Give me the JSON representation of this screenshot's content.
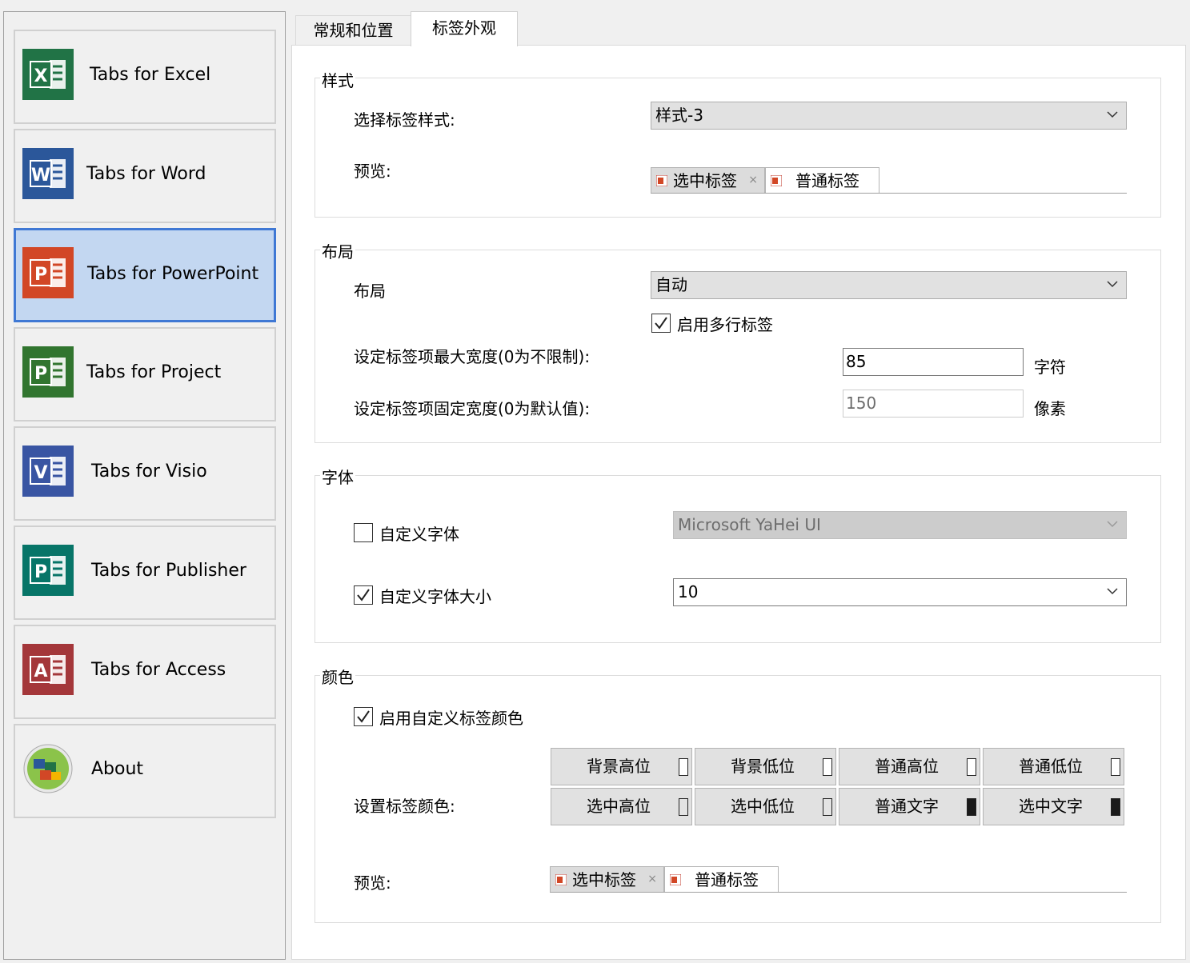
{
  "sidebar": {
    "items": [
      {
        "label": "Tabs for Excel",
        "icon": "excel-icon",
        "color": "#217346",
        "letter": "X",
        "selected": false
      },
      {
        "label": "Tabs for Word",
        "icon": "word-icon",
        "color": "#2b579a",
        "letter": "W",
        "selected": false
      },
      {
        "label": "Tabs for PowerPoint",
        "icon": "powerpoint-icon",
        "color": "#d24726",
        "letter": "P",
        "selected": true
      },
      {
        "label": "Tabs for Project",
        "icon": "project-icon",
        "color": "#31752f",
        "letter": "P",
        "selected": false
      },
      {
        "label": "Tabs for Visio",
        "icon": "visio-icon",
        "color": "#3955a3",
        "letter": "V",
        "selected": false
      },
      {
        "label": "Tabs for Publisher",
        "icon": "publisher-icon",
        "color": "#077568",
        "letter": "P",
        "selected": false
      },
      {
        "label": "Tabs for Access",
        "icon": "access-icon",
        "color": "#a4373a",
        "letter": "A",
        "selected": false
      },
      {
        "label": "About",
        "icon": "about-icon",
        "color": "#7cb342",
        "letter": "",
        "selected": false
      }
    ]
  },
  "tabs": [
    {
      "label": "常规和位置",
      "active": false
    },
    {
      "label": "标签外观",
      "active": true
    }
  ],
  "style_group": {
    "title": "样式",
    "select_label": "选择标签样式:",
    "select_value": "样式-3",
    "preview_label": "预览:",
    "preview_selected_tab": "选中标签",
    "preview_normal_tab": "普通标签",
    "preview_close": "×"
  },
  "layout_group": {
    "title": "布局",
    "layout_label": "布局",
    "layout_value": "自动",
    "multiline_label": "启用多行标签",
    "multiline_checked": true,
    "max_width_label": "设定标签项最大宽度(0为不限制):",
    "max_width_value": "85",
    "max_width_unit": "字符",
    "fixed_width_label": "设定标签项固定宽度(0为默认值):",
    "fixed_width_value": "150",
    "fixed_width_unit": "像素"
  },
  "font_group": {
    "title": "字体",
    "custom_font_label": "自定义字体",
    "custom_font_checked": false,
    "font_value": "Microsoft YaHei UI",
    "custom_size_label": "自定义字体大小",
    "custom_size_checked": true,
    "size_value": "10"
  },
  "color_group": {
    "title": "颜色",
    "enable_label": "启用自定义标签颜色",
    "enable_checked": true,
    "set_label": "设置标签颜色:",
    "buttons": [
      {
        "label": "背景高位",
        "swatch": "#ffffff"
      },
      {
        "label": "背景低位",
        "swatch": "#ffffff"
      },
      {
        "label": "普通高位",
        "swatch": "#ffffff"
      },
      {
        "label": "普通低位",
        "swatch": "#ffffff"
      },
      {
        "label": "选中高位",
        "swatch": "#e3e3e3"
      },
      {
        "label": "选中低位",
        "swatch": "#e3e3e3"
      },
      {
        "label": "普通文字",
        "swatch": "#1a1a1a"
      },
      {
        "label": "选中文字",
        "swatch": "#1a1a1a"
      }
    ],
    "preview_label": "预览:",
    "preview_selected_tab": "选中标签",
    "preview_normal_tab": "普通标签",
    "preview_close": "×"
  },
  "colors": {
    "selection_bg": "#c3d7f1",
    "selection_border": "#3f78d4",
    "powerpoint": "#d24726"
  }
}
